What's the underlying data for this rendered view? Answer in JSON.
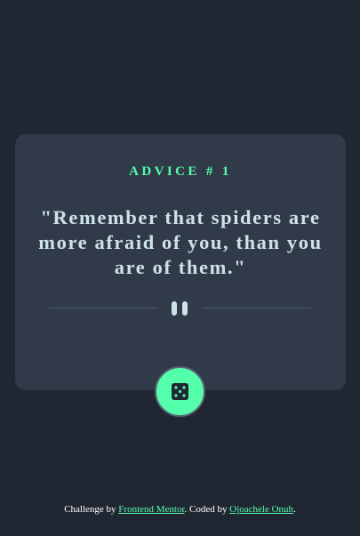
{
  "advice": {
    "id_label": "ADVICE # 1",
    "quote": "\"Remember that spiders are more afraid of you, than you are of them.\""
  },
  "dice_button": {
    "icon": "dice-icon"
  },
  "footer": {
    "prefix": "Challenge by ",
    "challenge_link": "Frontend Mentor",
    "middle": ". Coded by ",
    "author_link": "Ojoachele Onuh",
    "suffix": "."
  },
  "colors": {
    "background": "#202733",
    "card": "#313a48",
    "accent": "#53ffab",
    "text": "#cee3e9",
    "divider": "#4f5d74"
  }
}
